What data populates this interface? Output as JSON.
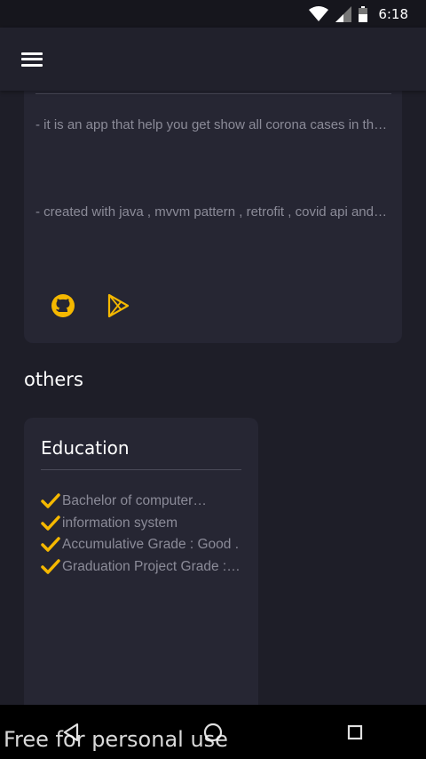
{
  "status_bar": {
    "time": "6:18",
    "icons": [
      "wifi-icon",
      "signal-icon",
      "battery-icon"
    ]
  },
  "app_bar": {
    "menu_icon": "hamburger-menu-icon"
  },
  "project_card": {
    "description_1": "- it is an app that help you get show all corona cases in the world",
    "description_2": "- created with java , mvvm pattern , retrofit , covid api and more",
    "links": [
      "github-icon",
      "google-play-icon"
    ]
  },
  "others_section": {
    "title": "others"
  },
  "education_card": {
    "title": "Education",
    "items": [
      "Bachelor of computer science",
      "information system",
      "Accumulative Grade : Good .",
      "Graduation Project Grade : Excellent"
    ]
  },
  "nav_bar": {
    "buttons": [
      "back-icon",
      "home-icon",
      "recents-icon"
    ]
  },
  "watermark": "Free for personal use",
  "colors": {
    "background": "#1e1e28",
    "card": "#262633",
    "accent": "#f5b800",
    "muted_text": "#8b8b98"
  }
}
